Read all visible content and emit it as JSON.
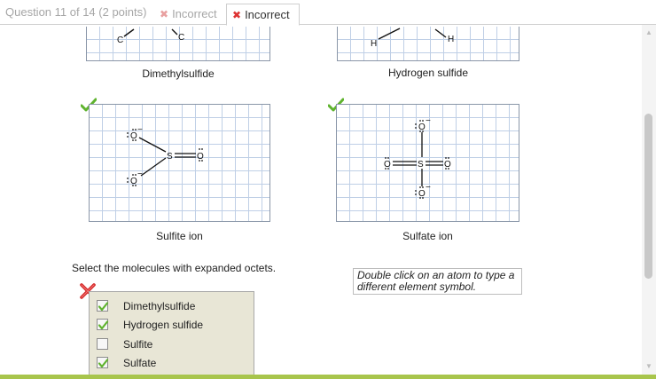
{
  "header": {
    "question_label": "Question 11 of 14 (2 points)",
    "tabs": [
      {
        "label": "Incorrect",
        "icon": "x-icon",
        "active": false
      },
      {
        "label": "Incorrect",
        "icon": "x-icon",
        "active": true
      }
    ]
  },
  "molecules": {
    "dimethylsulfide": {
      "label": "Dimethylsulfide",
      "atoms": [
        "C",
        "C"
      ]
    },
    "hydrogen_sulfide": {
      "label": "Hydrogen sulfide",
      "atoms": [
        "H",
        "H"
      ]
    },
    "sulfite": {
      "label": "Sulfite ion",
      "atoms": [
        "O",
        "S",
        "O",
        "O"
      ],
      "charges": [
        "−",
        "−"
      ],
      "correct": true
    },
    "sulfate": {
      "label": "Sulfate ion",
      "atoms": [
        "O",
        "O",
        "S",
        "O",
        "O"
      ],
      "charges": [
        "−",
        "−"
      ],
      "correct": true
    }
  },
  "question": {
    "prompt": "Select the molecules with expanded octets.",
    "hint": "Double click on an atom to type a different element symbol.",
    "result": "incorrect",
    "options": [
      {
        "label": "Dimethylsulfide",
        "checked": true
      },
      {
        "label": "Hydrogen sulfide",
        "checked": true
      },
      {
        "label": "Sulfite",
        "checked": false
      },
      {
        "label": "Sulfate",
        "checked": true
      }
    ]
  },
  "colors": {
    "check_green": "#5fb32e",
    "error_red": "#d32626",
    "grid_line": "#bfcfe6",
    "accent_bar": "#a8c54c"
  }
}
